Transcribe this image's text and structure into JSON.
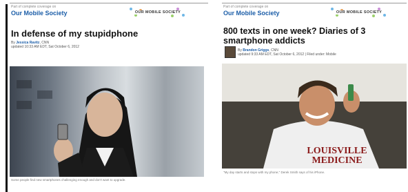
{
  "articles": [
    {
      "part_of": "Part of complete coverage on",
      "series": "Our Mobile Society",
      "badge": "OUR MOBILE SOCIETY",
      "headline": "In defense of my stupidphone",
      "byline_prefix": "By",
      "author": "Jessica Ravitz",
      "outlet": ", CNN",
      "updated": "updated 10:33 AM EDT, Sat October 6, 2012",
      "caption": "Some people find new smartphones challenging enough and don't want to upgrade."
    },
    {
      "part_of": "Part of complete coverage on",
      "series": "Our Mobile Society",
      "badge": "OUR MOBILE SOCIETY",
      "headline": "800 texts in one week? Diaries of 3 smartphone addicts",
      "byline_prefix": "By",
      "author": "Brandon Griggs",
      "outlet": ", CNN",
      "updated": "updated 9:33 AM EDT, Sat October 6, 2012 | Filed under: Mobile",
      "photo_text_line1": "LOUISVILLE",
      "photo_text_line2": "MEDICINE",
      "caption": "\"My day starts and stops with my phone,\" Derek Smith says of his iPhone."
    }
  ],
  "colors": {
    "link": "#1c5ea8",
    "headline": "#111111",
    "rule": "#111111"
  }
}
